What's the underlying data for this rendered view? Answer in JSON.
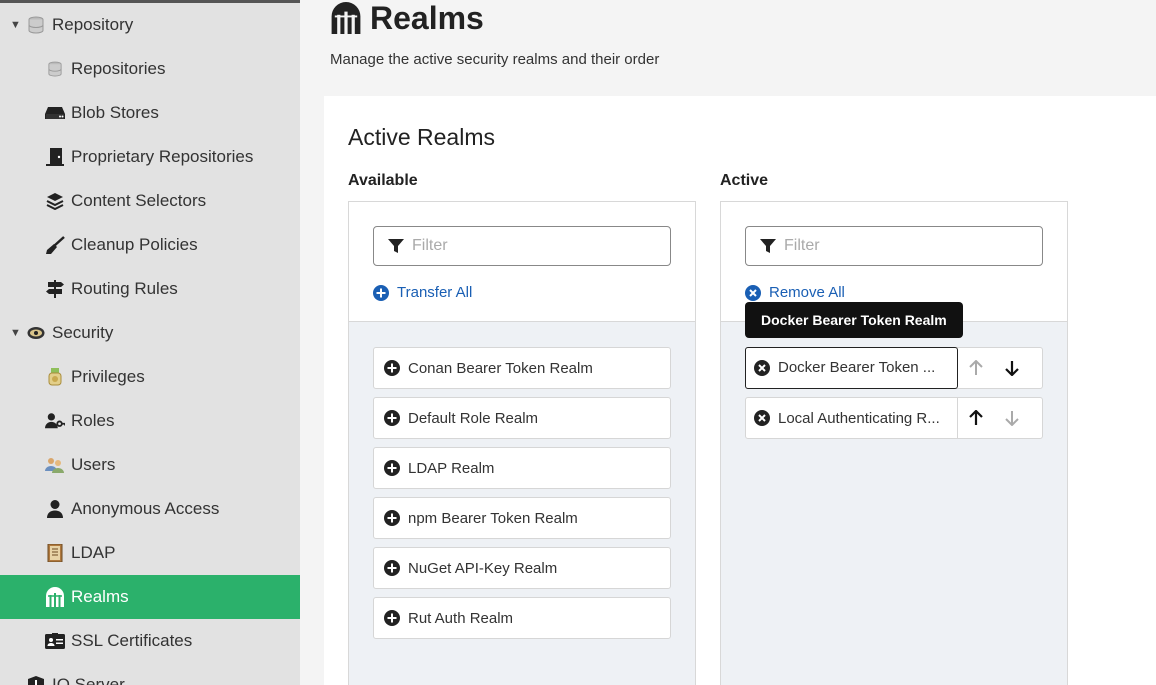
{
  "sidebar": {
    "repository": {
      "label": "Repository",
      "icon": "database-icon"
    },
    "repository_items": [
      {
        "label": "Repositories",
        "icon": "database-icon"
      },
      {
        "label": "Blob Stores",
        "icon": "hdd-icon"
      },
      {
        "label": "Proprietary Repositories",
        "icon": "door-icon"
      },
      {
        "label": "Content Selectors",
        "icon": "layers-icon"
      },
      {
        "label": "Cleanup Policies",
        "icon": "broom-icon"
      },
      {
        "label": "Routing Rules",
        "icon": "signpost-icon"
      }
    ],
    "security": {
      "label": "Security",
      "icon": "eye-badge-icon"
    },
    "security_items": [
      {
        "label": "Privileges",
        "icon": "medal-icon"
      },
      {
        "label": "Roles",
        "icon": "user-key-icon"
      },
      {
        "label": "Users",
        "icon": "users-icon"
      },
      {
        "label": "Anonymous Access",
        "icon": "user-icon"
      },
      {
        "label": "LDAP",
        "icon": "book-icon"
      },
      {
        "label": "Realms",
        "icon": "realm-gate-icon"
      },
      {
        "label": "SSL Certificates",
        "icon": "id-card-icon"
      }
    ],
    "iq_server": {
      "label": "IQ Server",
      "icon": "shield-icon"
    },
    "active_color": "#2bb16b"
  },
  "page": {
    "title": "Realms",
    "subtitle": "Manage the active security realms and their order"
  },
  "card": {
    "title": "Active Realms",
    "available": {
      "label": "Available",
      "filter_placeholder": "Filter",
      "transfer_all": "Transfer All",
      "items": [
        "Conan Bearer Token Realm",
        "Default Role Realm",
        "LDAP Realm",
        "npm Bearer Token Realm",
        "NuGet API-Key Realm",
        "Rut Auth Realm"
      ]
    },
    "active": {
      "label": "Active",
      "filter_placeholder": "Filter",
      "remove_all": "Remove All",
      "items": [
        {
          "label": "Docker Bearer Token ...",
          "up_enabled": false,
          "down_enabled": true
        },
        {
          "label": "Local Authenticating R...",
          "up_enabled": true,
          "down_enabled": false
        }
      ]
    }
  },
  "tooltip": {
    "text": "Docker Bearer Token Realm"
  }
}
